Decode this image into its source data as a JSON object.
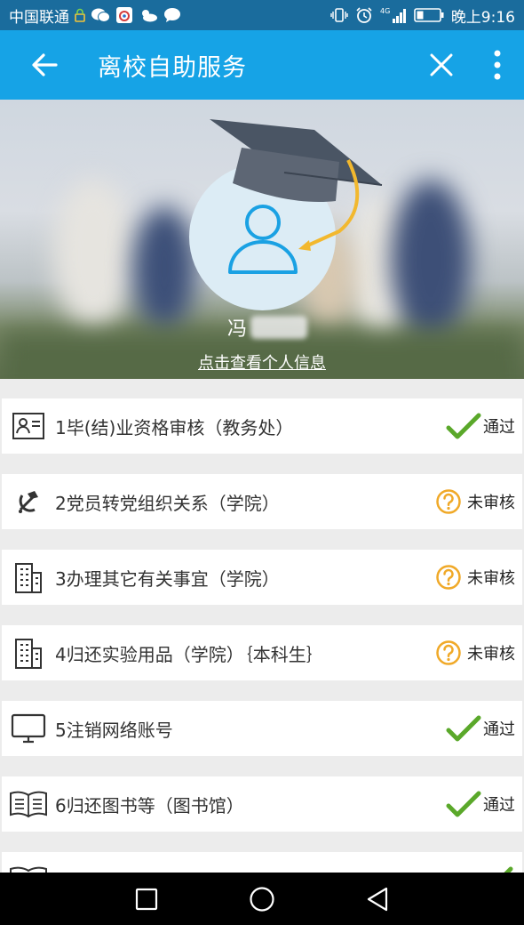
{
  "status_bar": {
    "carrier": "中国联通",
    "time": "晚上9:16",
    "network": "4G"
  },
  "app_bar": {
    "title": "离校自助服务",
    "back_icon": "arrow-left-icon",
    "close_icon": "close-icon",
    "more_icon": "more-vertical-icon"
  },
  "profile": {
    "name": "冯",
    "link_text": "点击查看个人信息"
  },
  "items": [
    {
      "label": "1毕(结)业资格审核（教务处）",
      "icon": "id-card-icon",
      "status": "通过",
      "state": "pass"
    },
    {
      "label": "2党员转党组织关系（学院）",
      "icon": "hammer-sickle-icon",
      "status": "未审核",
      "state": "pending"
    },
    {
      "label": "3办理其它有关事宜（学院）",
      "icon": "building-icon",
      "status": "未审核",
      "state": "pending"
    },
    {
      "label": "4归还实验用品（学院）｛本科生｝",
      "icon": "building-icon",
      "status": "未审核",
      "state": "pending"
    },
    {
      "label": "5注销网络账号",
      "icon": "monitor-icon",
      "status": "通过",
      "state": "pass"
    },
    {
      "label": "6归还图书等（图书馆）",
      "icon": "book-icon",
      "status": "通过",
      "state": "pass"
    },
    {
      "label": "",
      "icon": "book-icon",
      "status": "",
      "state": "pass"
    }
  ],
  "colors": {
    "app_bar": "#16a3e6",
    "status_bar": "#1a6c9d",
    "pass_check": "#5aa82a",
    "pending": "#f0a928"
  }
}
